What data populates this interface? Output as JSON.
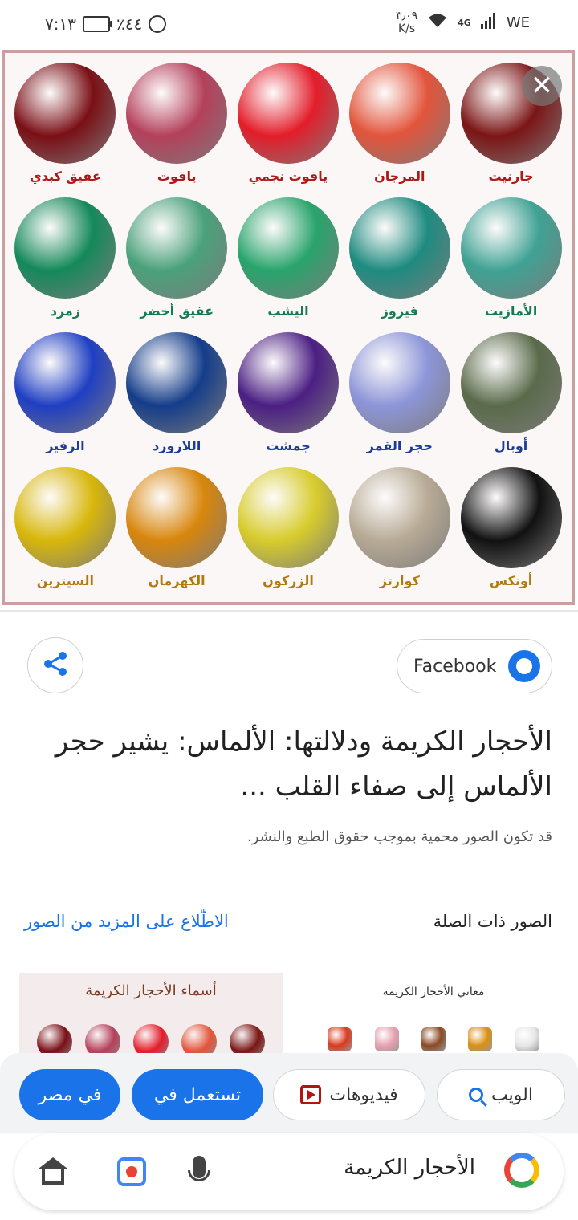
{
  "status_bar": {
    "time": "٧:١٣",
    "battery": "٪٤٤",
    "speed_value": "٣٫٠٩",
    "speed_unit": "K/s",
    "network": "4G",
    "carrier": "WE"
  },
  "image": {
    "gems": [
      {
        "label": "جارنيت",
        "color": "#7b1515"
      },
      {
        "label": "المرجان",
        "color": "#e2543b"
      },
      {
        "label": "ياقوت نجمي",
        "color": "#e31d2a"
      },
      {
        "label": "ياقوت",
        "color": "#b4405b"
      },
      {
        "label": "عقيق كبدي",
        "color": "#7a0f16"
      },
      {
        "label": "الأمازيت",
        "color": "#3fa294"
      },
      {
        "label": "فيروز",
        "color": "#1e8b80"
      },
      {
        "label": "اليشب",
        "color": "#28a46c"
      },
      {
        "label": "عقيق أخضر",
        "color": "#4aa17b"
      },
      {
        "label": "زمرد",
        "color": "#14895a"
      },
      {
        "label": "أوبال",
        "color": "#5a6a4a"
      },
      {
        "label": "حجر القمر",
        "color": "#8d96d8"
      },
      {
        "label": "جمشت",
        "color": "#4b1f83"
      },
      {
        "label": "اللازورد",
        "color": "#143d8a"
      },
      {
        "label": "الزفير",
        "color": "#1f3fc2"
      },
      {
        "label": "أونكس",
        "color": "#111111"
      },
      {
        "label": "كوارتز",
        "color": "#b8ab96"
      },
      {
        "label": "الزركون",
        "color": "#d7cc2c"
      },
      {
        "label": "الكهرمان",
        "color": "#d8860c"
      },
      {
        "label": "السيترين",
        "color": "#d8b70b"
      }
    ],
    "close_glyph": "✕"
  },
  "result": {
    "source": "Facebook",
    "title": "الأحجار الكريمة ودلالتها: الألماس: يشير حجر الألماس إلى صفاء القلب ...",
    "copyright": "قد تكون الصور محمية بموجب حقوق الطبع والنشر."
  },
  "related": {
    "title": "الصور ذات الصلة",
    "more": "الاطّلاع على المزيد من الصور",
    "thumbs": [
      {
        "title": "أسماء الأحجار الكريمة",
        "colors": [
          "#7a0f16",
          "#b4405b",
          "#e31d2a",
          "#e2543b",
          "#7b1515"
        ]
      },
      {
        "title": "معاني الأحجار الكريمة",
        "colors": [
          "#d93a1e",
          "#e8a0b0",
          "#8a4a25",
          "#d99014",
          "#e7e7e7"
        ]
      }
    ]
  },
  "chips": [
    {
      "label": "الويب",
      "icon": "search-icon"
    },
    {
      "label": "فيديوهات",
      "icon": "video-icon"
    },
    {
      "label": "تستعمل في"
    },
    {
      "label": "في مصر"
    }
  ],
  "search": {
    "query": "الأحجار الكريمة"
  }
}
